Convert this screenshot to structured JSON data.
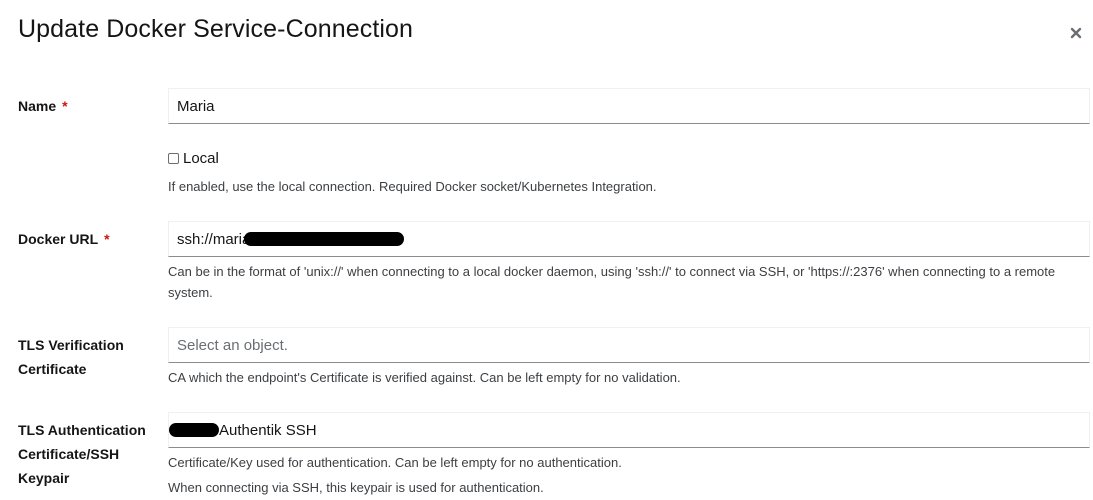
{
  "modal": {
    "title": "Update Docker Service-Connection",
    "close_icon": "close-icon"
  },
  "form": {
    "name": {
      "label": "Name",
      "required_marker": "*",
      "value": "Maria"
    },
    "local": {
      "label": "Local",
      "checked": false,
      "help": "If enabled, use the local connection. Required Docker socket/Kubernetes Integration."
    },
    "docker_url": {
      "label": "Docker URL",
      "required_marker": "*",
      "value": "ssh://maria",
      "redacted": true,
      "help": "Can be in the format of 'unix://' when connecting to a local docker daemon, using 'ssh://' to connect via SSH, or 'https://:2376' when connecting to a remote system."
    },
    "tls_verification": {
      "label_line1": "TLS Verification",
      "label_line2": "Certificate",
      "placeholder": "Select an object.",
      "help": "CA which the endpoint's Certificate is verified against. Can be left empty for no validation."
    },
    "tls_authentication": {
      "label_line1": "TLS Authentication",
      "label_line2": "Certificate/SSH",
      "label_line3": "Keypair",
      "value": "Authentik SSH",
      "redacted_prefix": true,
      "help_line1": "Certificate/Key used for authentication. Can be left empty for no authentication.",
      "help_line2": "When connecting via SSH, this keypair is used for authentication."
    }
  }
}
